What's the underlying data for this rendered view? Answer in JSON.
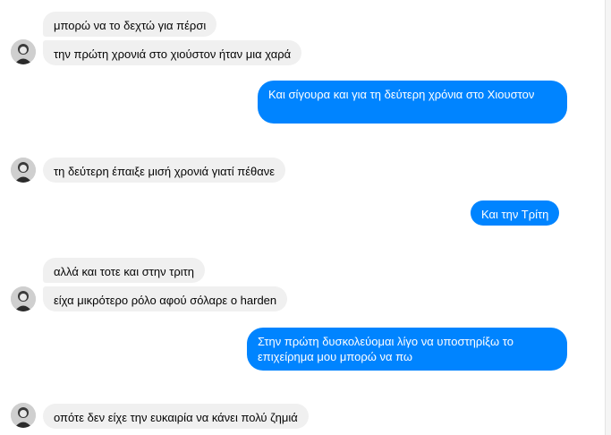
{
  "messages": [
    {
      "id": "m1",
      "side": "in",
      "text": "μπορώ να το δεχτώ για πέρσι"
    },
    {
      "id": "m2",
      "side": "in",
      "text": "την πρώτη χρονιά στο χιούστον ήταν μια χαρά"
    },
    {
      "id": "m3",
      "side": "out",
      "text": "Και σίγουρα και για τη δεύτερη χρόνια στο Χιουστον"
    },
    {
      "id": "m4",
      "side": "in",
      "text": "τη δεύτερη έπαιξε μισή χρονιά γιατί πέθανε"
    },
    {
      "id": "m5",
      "side": "out",
      "text": "Και την Τρίτη"
    },
    {
      "id": "m6",
      "side": "in",
      "text": "αλλά και τοτε και στην τριτη"
    },
    {
      "id": "m7",
      "side": "in",
      "text": "είχα μικρότερο ρόλο αφού σόλαρε ο harden"
    },
    {
      "id": "m8",
      "side": "out",
      "text": "Στην πρώτη δυσκολεύομαι λίγο να υποστηρίξω το επιχείρημα μου μπορώ να πω"
    },
    {
      "id": "m9",
      "side": "in",
      "text": "οπότε δεν είχε την ευκαιρία να κάνει πολύ ζημιά"
    }
  ],
  "colors": {
    "outgoing": "#0084ff",
    "incoming": "#f0f0f0"
  },
  "icons": {
    "avatar": "contact-avatar-icon"
  }
}
